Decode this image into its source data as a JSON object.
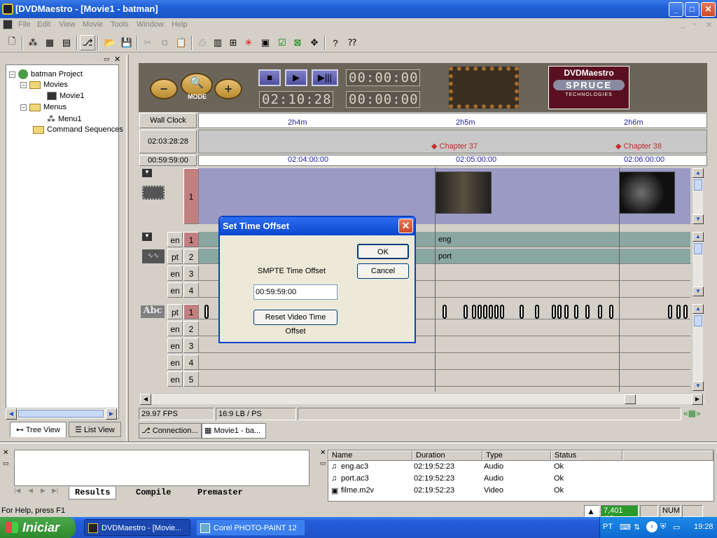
{
  "window": {
    "title": "[DVDMaestro - [Movie1 - batman]",
    "title_plain": "DVDMaestro - [Movie1 - batman]"
  },
  "menu": [
    "File",
    "Edit",
    "View",
    "Movie",
    "Tools",
    "Window",
    "Help"
  ],
  "tree": {
    "root": "batman Project",
    "movies": "Movies",
    "movie1": "Movie1",
    "menus": "Menus",
    "menu1": "Menu1",
    "commands": "Command Sequences"
  },
  "left_tabs": {
    "tree": "Tree View",
    "list": "List View"
  },
  "header": {
    "mode_label": "MODE",
    "minus": "−",
    "plus": "+",
    "lcd1": "00:00:00:0",
    "lcd2": "02:10:28:1",
    "lcd3": "00:00:00:0",
    "lcd4": "00:00:00:0",
    "logo_top": "DVDMaestro",
    "logo_mid": "SPRUCE",
    "logo_bottom": "TECHNOLOGIES"
  },
  "rulers": {
    "wallclock_label": "Wall Clock",
    "tick_2h4m": "2h4m",
    "tick_2h5m": "2h5m",
    "tick_2h6m": "2h6m",
    "chapter_time": "02:03:28:28",
    "chapter37": "Chapter 37",
    "chapter38": "Chapter 38",
    "offset_time": "00:59:59:00",
    "tc_0204": "02:04:00:00",
    "tc_0205": "02:05:00:00",
    "tc_0206": "02:06:00:00"
  },
  "video_track": {
    "number": "1"
  },
  "audio_tracks": [
    {
      "lang": "en",
      "num": "1",
      "clip": "eng"
    },
    {
      "lang": "pt",
      "num": "2",
      "clip": "port"
    },
    {
      "lang": "en",
      "num": "3",
      "clip": ""
    },
    {
      "lang": "en",
      "num": "4",
      "clip": ""
    }
  ],
  "subtitle_tracks": [
    {
      "lang": "pt",
      "num": "1"
    },
    {
      "lang": "en",
      "num": "2"
    },
    {
      "lang": "en",
      "num": "3"
    },
    {
      "lang": "en",
      "num": "4"
    },
    {
      "lang": "en",
      "num": "5"
    }
  ],
  "subtitle_icon": "Abc",
  "status_main": {
    "fps": "29.97 FPS",
    "aspect": "16:9 LB / PS"
  },
  "doc_tabs": {
    "connection": "Connection...",
    "movie": "Movie1 - ba..."
  },
  "dialog": {
    "title": "Set Time Offset",
    "ok": "OK",
    "cancel": "Cancel",
    "smpte_label": "SMPTE Time Offset",
    "smpte_value": "00:59:59:00",
    "reset": "Reset Video Time Offset"
  },
  "output_tabs": [
    "Results",
    "Compile",
    "Premaster"
  ],
  "files": {
    "headers": [
      "Name",
      "Duration",
      "Type",
      "Status"
    ],
    "rows": [
      {
        "name": "eng.ac3",
        "duration": "02:19:52:23",
        "type": "Audio",
        "status": "Ok"
      },
      {
        "name": "port.ac3",
        "duration": "02:19:52:23",
        "type": "Audio",
        "status": "Ok"
      },
      {
        "name": "filme.m2v",
        "duration": "02:19:52:23",
        "type": "Video",
        "status": "Ok"
      }
    ]
  },
  "statusbar": {
    "help": "For Help, press F1",
    "disk": "7,401 GB",
    "num": "NUM"
  },
  "taskbar": {
    "start": "Iniciar",
    "task1": "DVDMaestro - [Movie...",
    "task2": "Corel PHOTO-PAINT 12",
    "lang": "PT",
    "clock": "19:28"
  }
}
